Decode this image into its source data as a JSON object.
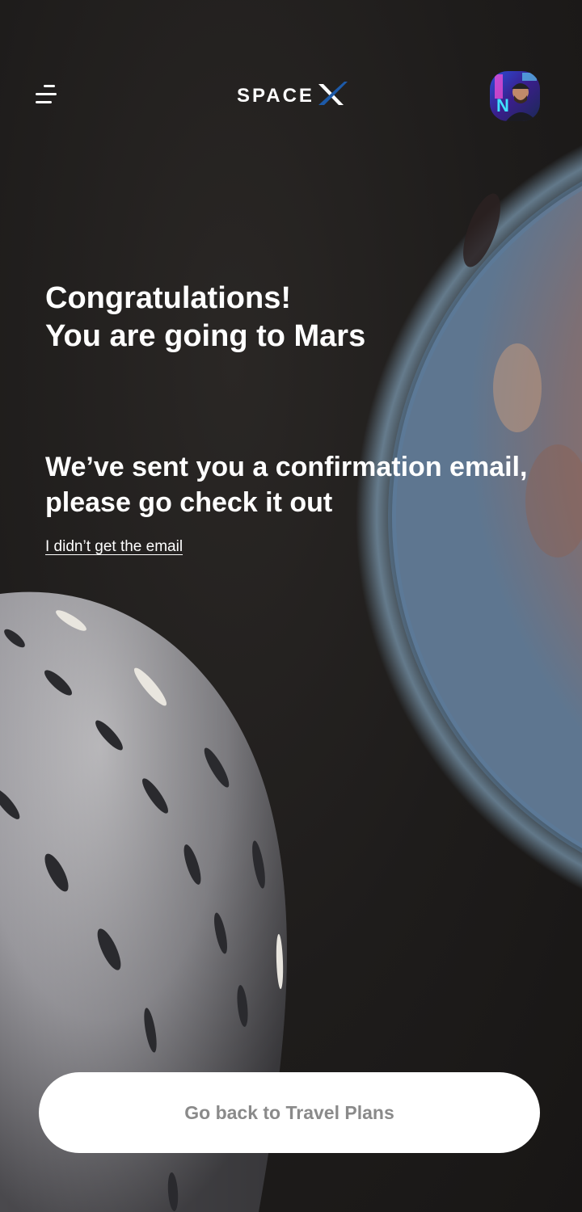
{
  "header": {
    "menu_icon": "menu-icon",
    "logo_text": "SPACE",
    "avatar_icon": "user-avatar"
  },
  "main": {
    "headline_line1": "Congratulations!",
    "headline_line2": "You are going to Mars",
    "subheadline": "We’ve sent you a confirmation email, please go check it out",
    "resend_link": "I didn’t get the email"
  },
  "footer": {
    "cta_label": "Go back to Travel Plans"
  },
  "colors": {
    "background": "#1e1c1b",
    "text": "#ffffff",
    "button_bg": "#ffffff",
    "button_text": "#8a8a8a",
    "logo_x_accent": "#1d5aa8"
  }
}
